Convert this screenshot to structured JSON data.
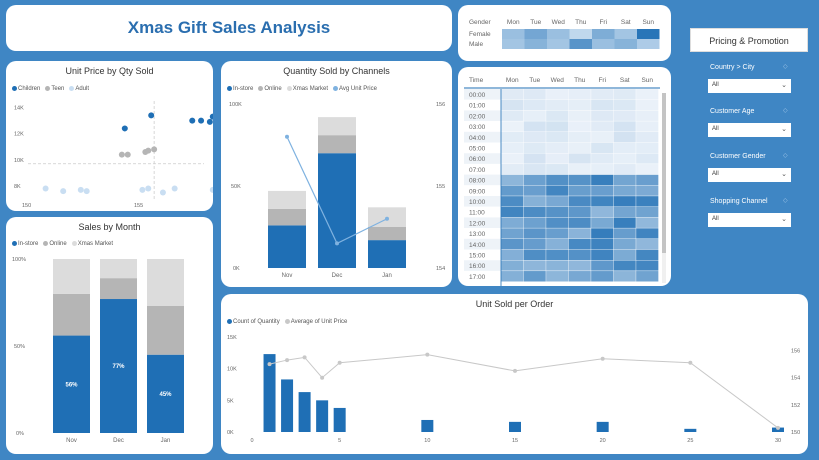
{
  "title": "Xmas Gift Sales Analysis",
  "side_title": "Pricing & Promotion",
  "slicers": [
    {
      "label": "Country > City",
      "value": "All"
    },
    {
      "label": "Customer Age",
      "value": "All"
    },
    {
      "label": "Customer Gender",
      "value": "All"
    },
    {
      "label": "Shopping Channel",
      "value": "All"
    }
  ],
  "gender_heatmap": {
    "header": "Gender",
    "days": [
      "Mon",
      "Tue",
      "Wed",
      "Thu",
      "Fri",
      "Sat",
      "Sun"
    ],
    "rows": [
      {
        "label": "Female",
        "shades": [
          0.35,
          0.55,
          0.35,
          0.15,
          0.5,
          0.3,
          0.95
        ]
      },
      {
        "label": "Male",
        "shades": [
          0.3,
          0.45,
          0.3,
          0.7,
          0.35,
          0.45,
          0.25
        ]
      }
    ]
  },
  "time_heatmap": {
    "header": "Time",
    "days": [
      "Mon",
      "Tue",
      "Wed",
      "Thu",
      "Fri",
      "Sat",
      "Sun"
    ],
    "hours": [
      "00:00",
      "01:00",
      "02:00",
      "03:00",
      "04:00",
      "05:00",
      "06:00",
      "07:00",
      "08:00",
      "09:00",
      "10:00",
      "11:00",
      "12:00",
      "13:00",
      "14:00",
      "15:00",
      "16:00",
      "17:00"
    ]
  },
  "chart_data": [
    {
      "type": "scatter",
      "title": "Unit Price by Qty Sold",
      "legend": [
        "Children",
        "Teen",
        "Adult"
      ],
      "colors": [
        "#1f6fb5",
        "#b5b5b5",
        "#c9def2"
      ],
      "y_ticks": [
        "14K",
        "12K",
        "10K",
        "8K"
      ],
      "x_ticks": [
        "150",
        "155"
      ],
      "xlim": [
        150,
        156
      ],
      "ylim": [
        7000,
        14500
      ],
      "series": [
        {
          "name": "Children",
          "points": [
            [
              154.2,
              13400
            ],
            [
              155.6,
              13000
            ],
            [
              155.9,
              13000
            ],
            [
              156.2,
              12900
            ],
            [
              156.5,
              12700
            ],
            [
              156.3,
              13300
            ],
            [
              153.3,
              12400
            ]
          ]
        },
        {
          "name": "Teen",
          "points": [
            [
              153.2,
              10400
            ],
            [
              153.4,
              10400
            ],
            [
              154.0,
              10600
            ],
            [
              154.1,
              10700
            ],
            [
              154.3,
              10800
            ]
          ]
        },
        {
          "name": "Adult",
          "points": [
            [
              150.6,
              7800
            ],
            [
              151.2,
              7600
            ],
            [
              151.8,
              7700
            ],
            [
              152.0,
              7600
            ],
            [
              153.9,
              7700
            ],
            [
              154.1,
              7800
            ],
            [
              154.6,
              7500
            ],
            [
              156.3,
              7700
            ],
            [
              155.0,
              7800
            ]
          ]
        }
      ]
    },
    {
      "type": "bar",
      "title": "Quantity Sold by Channels",
      "legend": [
        "In-store",
        "Online",
        "Xmas Market",
        "Avg Unit Price"
      ],
      "colors": [
        "#1f6fb5",
        "#b5b5b5",
        "#dcdcdc",
        "#7fb2e0"
      ],
      "categories": [
        "Nov",
        "Dec",
        "Jan"
      ],
      "y_ticks": [
        "100K",
        "50K",
        "0K"
      ],
      "y2_ticks": [
        "156",
        "155",
        "154"
      ],
      "ylim": [
        0,
        100000
      ],
      "series": [
        {
          "name": "In-store",
          "values": [
            26000,
            70000,
            17000
          ]
        },
        {
          "name": "Online",
          "values": [
            10000,
            11000,
            8000
          ]
        },
        {
          "name": "Xmas Market",
          "values": [
            11000,
            11000,
            12000
          ]
        },
        {
          "name": "Avg Unit Price",
          "values": [
            155.6,
            154.3,
            154.6
          ]
        }
      ]
    },
    {
      "type": "bar",
      "title": "Sales by Month",
      "legend": [
        "In-store",
        "Online",
        "Xmas Market"
      ],
      "colors": [
        "#1f6fb5",
        "#b5b5b5",
        "#dcdcdc"
      ],
      "categories": [
        "Nov",
        "Dec",
        "Jan"
      ],
      "y_ticks": [
        "100%",
        "50%",
        "0%"
      ],
      "series": [
        {
          "name": "In-store",
          "values": [
            56,
            77,
            45
          ]
        },
        {
          "name": "Online",
          "values": [
            24,
            12,
            28
          ]
        },
        {
          "name": "Xmas Market",
          "values": [
            20,
            11,
            27
          ]
        }
      ],
      "data_labels": [
        "56%",
        "77%",
        "45%"
      ]
    },
    {
      "type": "bar",
      "title": "Unit Sold per Order",
      "legend": [
        "Count of Quantity",
        "Average of Unit Price"
      ],
      "colors": [
        "#1f6fb5",
        "#c8c8c8"
      ],
      "x_ticks": [
        "0",
        "5",
        "10",
        "15",
        "20",
        "25",
        "30"
      ],
      "y_ticks": [
        "15K",
        "10K",
        "5K",
        "0K"
      ],
      "y2_ticks": [
        "156",
        "154",
        "152",
        "150"
      ],
      "xlim": [
        0,
        30
      ],
      "ylim": [
        0,
        15000
      ],
      "y2lim": [
        150,
        157
      ],
      "series": [
        {
          "name": "Count of Quantity",
          "x": [
            1,
            2,
            3,
            4,
            5,
            10,
            15,
            20,
            25,
            30
          ],
          "values": [
            12300,
            8300,
            6300,
            5000,
            3800,
            1900,
            1600,
            1600,
            500,
            700
          ]
        },
        {
          "name": "Average of Unit Price",
          "x": [
            1,
            2,
            3,
            4,
            5,
            10,
            15,
            20,
            25,
            30
          ],
          "values": [
            155.0,
            155.3,
            155.5,
            154.0,
            155.1,
            155.7,
            154.5,
            155.4,
            155.1,
            150.3
          ]
        }
      ]
    }
  ]
}
